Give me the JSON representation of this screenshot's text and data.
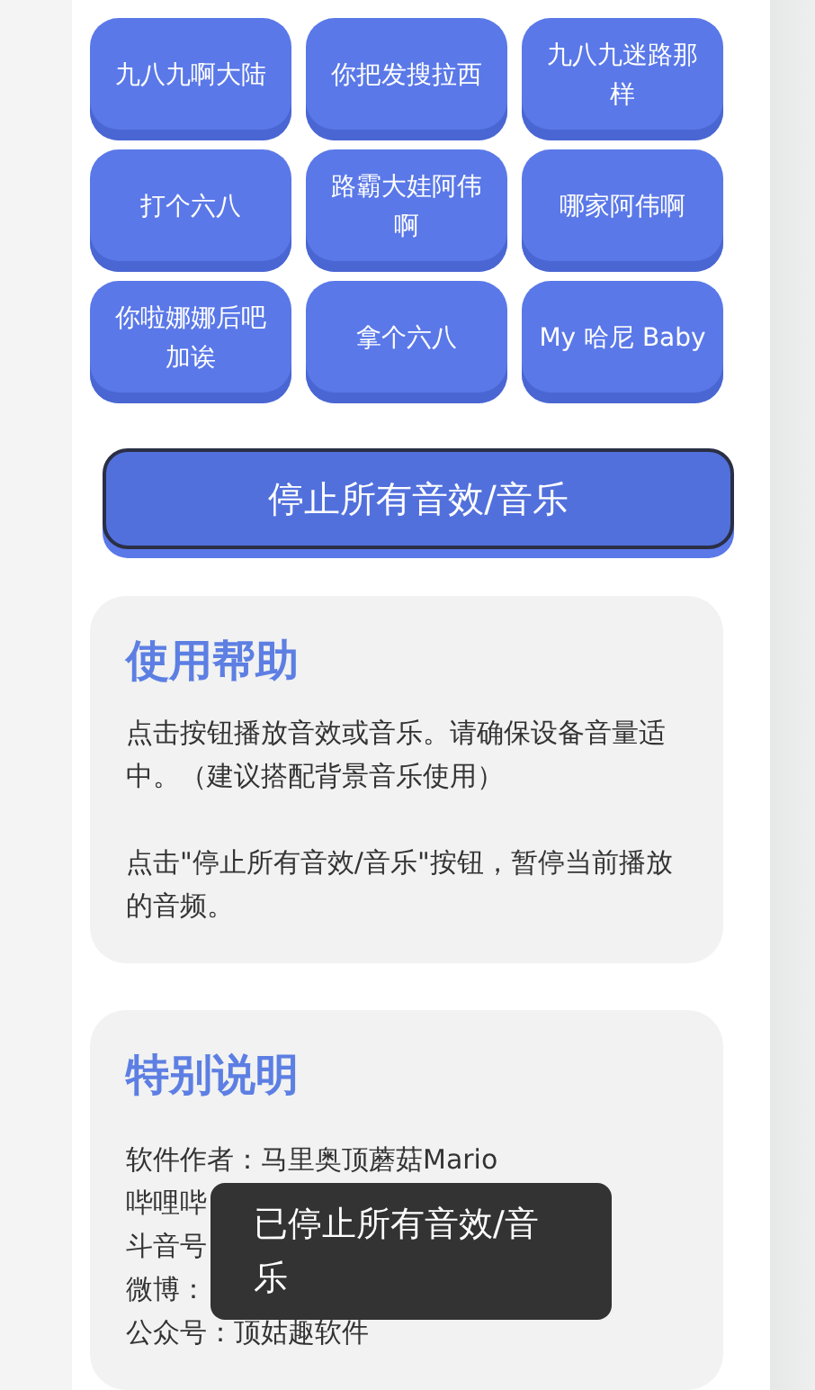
{
  "sound_buttons": [
    "九八九啊大陆",
    "你把发搜拉西",
    "九八九迷路那样",
    "打个六八",
    "路霸大娃阿伟啊",
    "哪家阿伟啊",
    "你啦娜娜后吧加诶",
    "拿个六八",
    "My 哈尼 Baby"
  ],
  "stop_button": {
    "label": "停止所有音效/音乐"
  },
  "help": {
    "title": "使用帮助",
    "paragraphs": [
      "点击按钮播放音效或音乐。请确保设备音量适中。（建议搭配背景音乐使用）",
      "点击\"停止所有音效/音乐\"按钮，暂停当前播放的音频。"
    ]
  },
  "notes": {
    "title": "特别说明",
    "lines": [
      "软件作者：马里奥顶蘑菇Mario",
      "哔哩哔",
      "斗音号",
      "微博：",
      "公众号：顶姑趣软件"
    ]
  },
  "toast": {
    "message": "已停止所有音效/音乐"
  }
}
